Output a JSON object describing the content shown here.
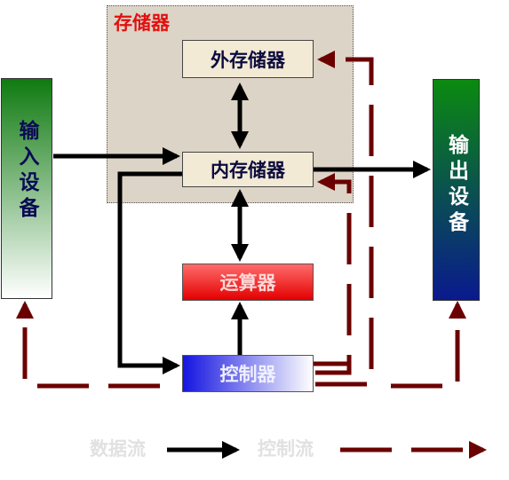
{
  "memory": {
    "title": "存储器"
  },
  "external_memory": {
    "label": "外存储器"
  },
  "internal_memory": {
    "label": "内存储器"
  },
  "alu": {
    "label": "运算器"
  },
  "controller": {
    "label": "控制器"
  },
  "input_device": {
    "label": "输入设备"
  },
  "output_device": {
    "label": "输出设备"
  },
  "legend": {
    "data_flow_label": "数据流",
    "control_flow_label": "控制流"
  },
  "colors": {
    "data_flow": "#000000",
    "control_flow": "#6b0000",
    "memory_title": "#e11010"
  }
}
